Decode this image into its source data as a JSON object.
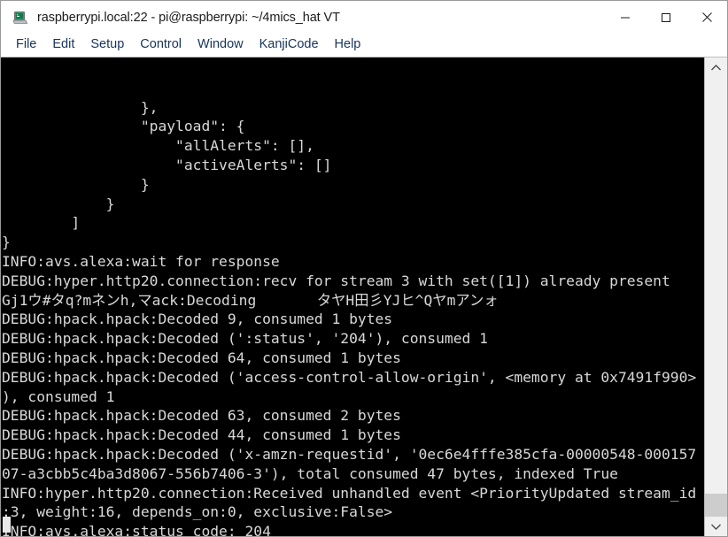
{
  "window": {
    "title": "raspberrypi.local:22 - pi@raspberrypi: ~/4mics_hat VT",
    "icon": "terminal-laptop-icon",
    "controls": {
      "minimize": "minimize-icon",
      "maximize": "maximize-icon",
      "close": "close-icon"
    }
  },
  "menubar": {
    "items": [
      {
        "label": "File"
      },
      {
        "label": "Edit"
      },
      {
        "label": "Setup"
      },
      {
        "label": "Control"
      },
      {
        "label": "Window"
      },
      {
        "label": "KanjiCode"
      },
      {
        "label": "Help"
      }
    ]
  },
  "terminal": {
    "background": "#000000",
    "foreground": "#d8d8d8",
    "cursor": "block-cursor",
    "lines": [
      "                },",
      "                \"payload\": {",
      "                    \"allAlerts\": [],",
      "                    \"activeAlerts\": []",
      "                }",
      "            }",
      "        ]",
      "}",
      "INFO:avs.alexa:wait for response",
      "DEBUG:hyper.http20.connection:recv for stream 3 with set([1]) already present",
      "Gj1ウ#タq?mネンh,マack:Decoding       タヤH田彡YJヒ^Qヤmアンォ",
      "DEBUG:hpack.hpack:Decoded 9, consumed 1 bytes",
      "DEBUG:hpack.hpack:Decoded (':status', '204'), consumed 1",
      "DEBUG:hpack.hpack:Decoded 64, consumed 1 bytes",
      "DEBUG:hpack.hpack:Decoded ('access-control-allow-origin', <memory at 0x7491f990>",
      "), consumed 1",
      "DEBUG:hpack.hpack:Decoded 63, consumed 2 bytes",
      "DEBUG:hpack.hpack:Decoded 44, consumed 1 bytes",
      "DEBUG:hpack.hpack:Decoded ('x-amzn-requestid', '0ec6e4fffe385cfa-00000548-000157",
      "07-a3cbb5c4ba3d8067-556b7406-3'), total consumed 47 bytes, indexed True",
      "INFO:hyper.http20.connection:Received unhandled event <PriorityUpdated stream_id",
      ":3, weight:16, depends_on:0, exclusive:False>",
      "INFO:avs.alexa:status code: 204"
    ]
  },
  "scrollbar": {
    "up_arrow": "chevron-up-icon",
    "down_arrow": "chevron-down-icon",
    "thumb": "scrollbar-thumb"
  }
}
